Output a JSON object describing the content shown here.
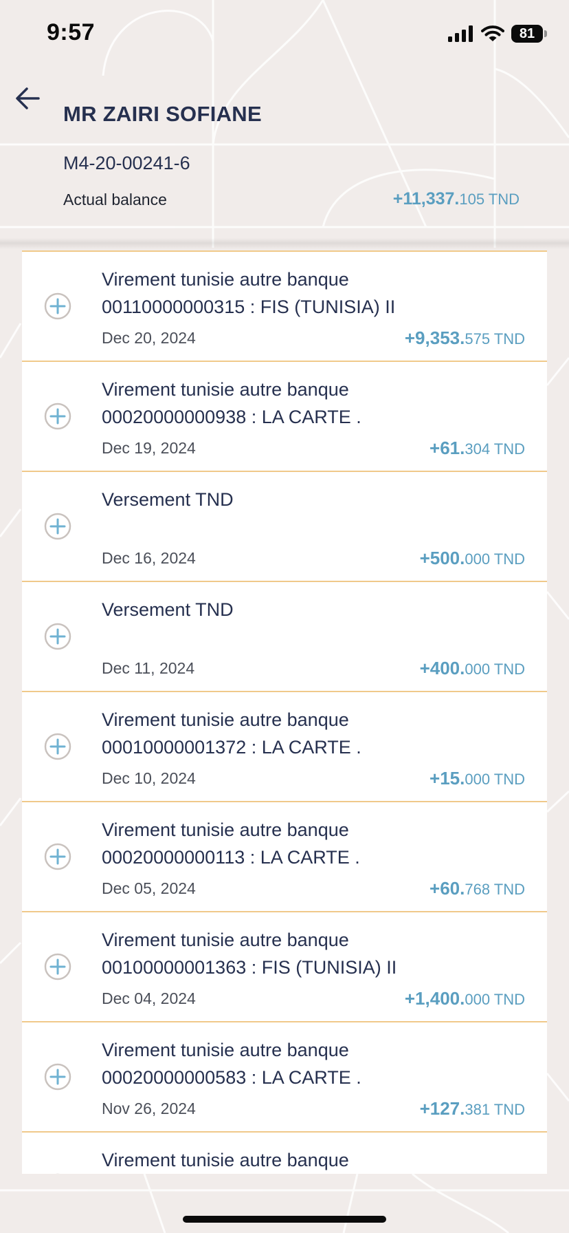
{
  "status_bar": {
    "time": "9:57",
    "battery": "81"
  },
  "header": {
    "back_icon": "arrow-left-icon",
    "account_name": "MR ZAIRI SOFIANE",
    "account_number": "M4-20-00241-6",
    "balance_label": "Actual balance",
    "balance_major": "+11,337.",
    "balance_minor": "105 TND"
  },
  "transactions": [
    {
      "line1": "Virement tunisie autre banque",
      "line2": "00110000000315 : FIS (TUNISIA) II",
      "date": "Dec 20, 2024",
      "amount_major": "+9,353.",
      "amount_minor": "575 TND"
    },
    {
      "line1": "Virement tunisie autre banque",
      "line2": "00020000000938 : LA CARTE .",
      "date": "Dec 19, 2024",
      "amount_major": "+61.",
      "amount_minor": "304 TND"
    },
    {
      "line1": "Versement TND",
      "line2": "",
      "date": "Dec 16, 2024",
      "amount_major": "+500.",
      "amount_minor": "000 TND"
    },
    {
      "line1": "Versement TND",
      "line2": "",
      "date": "Dec 11, 2024",
      "amount_major": "+400.",
      "amount_minor": "000 TND"
    },
    {
      "line1": "Virement tunisie autre banque",
      "line2": "00010000001372 : LA CARTE .",
      "date": "Dec 10, 2024",
      "amount_major": "+15.",
      "amount_minor": "000 TND"
    },
    {
      "line1": "Virement tunisie autre banque",
      "line2": "00020000000113 : LA CARTE .",
      "date": "Dec 05, 2024",
      "amount_major": "+60.",
      "amount_minor": "768 TND"
    },
    {
      "line1": "Virement tunisie autre banque",
      "line2": "00100000001363 : FIS (TUNISIA) II",
      "date": "Dec 04, 2024",
      "amount_major": "+1,400.",
      "amount_minor": "000 TND"
    },
    {
      "line1": "Virement tunisie autre banque",
      "line2": "00020000000583 : LA CARTE .",
      "date": "Nov 26, 2024",
      "amount_major": "+127.",
      "amount_minor": "381 TND"
    },
    {
      "line1": "Virement tunisie autre banque",
      "line2": "",
      "date": "",
      "amount_major": "",
      "amount_minor": ""
    }
  ],
  "icons": {
    "row_icon": "plus-circle-icon"
  },
  "colors": {
    "background": "#f1ecea",
    "text_primary": "#26304f",
    "amount": "#5a9ec0",
    "separator": "#f0c98a",
    "plus_icon": "#6fb2d2"
  }
}
